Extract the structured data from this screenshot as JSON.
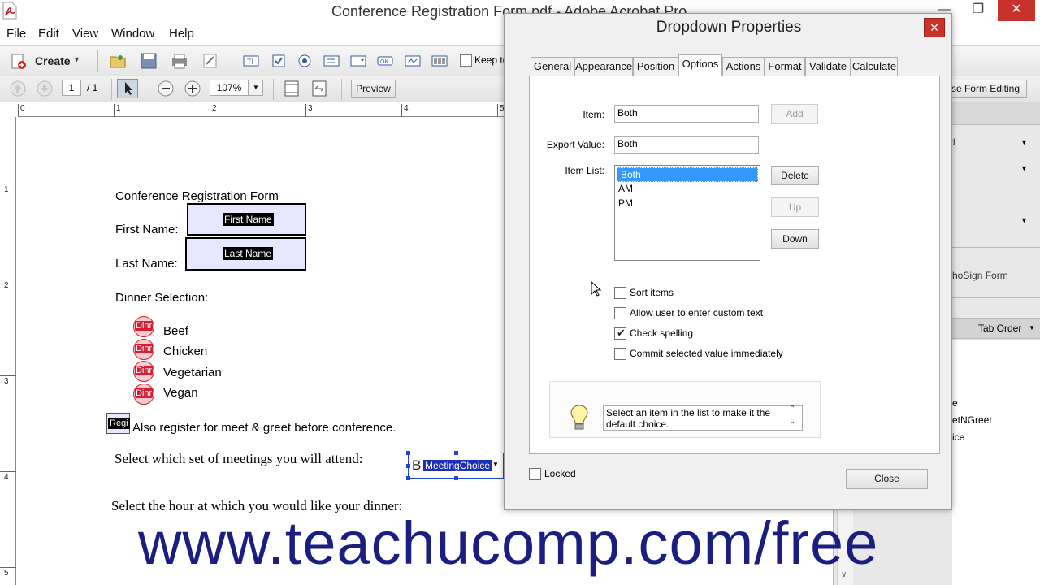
{
  "app": {
    "title": "Conference Registration Form.pdf - Adobe Acrobat Pro",
    "window_controls": [
      "—",
      "❐",
      "✕"
    ]
  },
  "menu": [
    "File",
    "Edit",
    "View",
    "Window",
    "Help"
  ],
  "toolbar": {
    "create_label": "Create",
    "keep_tool_label": "Keep to",
    "page_current": "1",
    "page_total": "/ 1",
    "zoom": "107%",
    "preview_label": "Preview",
    "close_form_editing_label": "se Form Editing"
  },
  "ruler": {
    "top": [
      "0",
      "1",
      "2",
      "3",
      "4",
      "5"
    ],
    "left": [
      "1",
      "2",
      "3",
      "4",
      "5"
    ]
  },
  "document": {
    "form_title": "Conference Registration Form",
    "first_name_label": "First Name:",
    "first_name_field": "First Name",
    "last_name_label": "Last Name:",
    "last_name_field": "Last Name",
    "dinner_label": "Dinner Selection:",
    "radio_tag": "Dinr",
    "dinner_options": [
      "Beef",
      "Chicken",
      "Vegetarian",
      "Vegan"
    ],
    "checkbox_tag": "Regi",
    "meet_greet_label": "Also register for meet & greet before conference.",
    "meetings_label": "Select which set of meetings you will attend:",
    "dropdown_prefix": "B",
    "dropdown_field": "MeetingChoice",
    "dinner_hour_label": "Select the hour at which you would like your dinner:"
  },
  "right_panel": {
    "echosign": "hoSign Form",
    "tab_order": "Tab Order",
    "fields_list": [
      "e",
      "etNGreet",
      "ice"
    ],
    "partial_d": "d"
  },
  "dialog": {
    "title": "Dropdown Properties",
    "tabs": [
      "General",
      "Appearance",
      "Position",
      "Options",
      "Actions",
      "Format",
      "Validate",
      "Calculate"
    ],
    "active_tab": "Options",
    "item_label": "Item:",
    "item_value": "Both",
    "add_label": "Add",
    "export_label": "Export Value:",
    "export_value": "Both",
    "item_list_label": "Item List:",
    "items": [
      "Both",
      "AM",
      "PM"
    ],
    "selected_item": "Both",
    "delete_label": "Delete",
    "up_label": "Up",
    "down_label": "Down",
    "checkboxes": [
      {
        "label": "Sort items",
        "checked": false
      },
      {
        "label": "Allow user to enter custom text",
        "checked": false
      },
      {
        "label": "Check spelling",
        "checked": true
      },
      {
        "label": "Commit selected value immediately",
        "checked": false
      }
    ],
    "hint": "Select an item in the list to make it the default choice.",
    "locked_label": "Locked",
    "close_label": "Close"
  },
  "watermark": "www.teachucomp.com/free",
  "colors": {
    "selection": "#3399ff",
    "field_fill": "#e6e6ff",
    "radio_red": "#d32037",
    "watermark": "#1b1e80",
    "close_red": "#c7322b"
  }
}
